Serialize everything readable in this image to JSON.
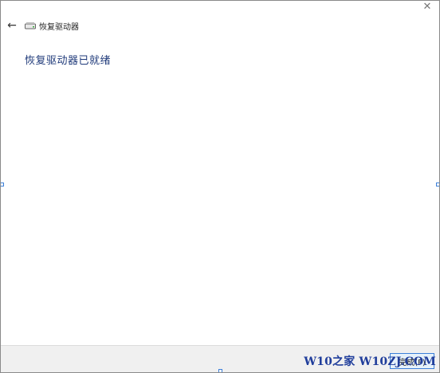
{
  "window": {
    "title": "恢复驱动器",
    "close_glyph": "✕",
    "back_glyph": "←"
  },
  "main": {
    "heading": "恢复驱动器已就绪"
  },
  "footer": {
    "finish_label": "完成(F)",
    "watermark": "W10之家 W10ZJ.COM"
  },
  "colors": {
    "heading": "#1f3a7a",
    "accent": "#3c7fd8",
    "watermark": "#1f3d9b"
  }
}
